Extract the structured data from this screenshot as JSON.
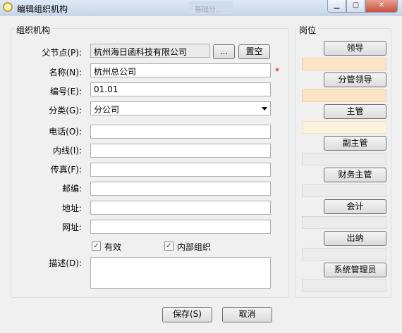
{
  "window": {
    "title": "编辑组织机构",
    "background_hint": "基础分..."
  },
  "org_group": {
    "title": "组织机构"
  },
  "fields": {
    "parent": {
      "label": "父节点(P):",
      "value": "杭州海日函科技有限公司",
      "browse_label": "...",
      "clear_label": "置空"
    },
    "name": {
      "label": "名称(N):",
      "value": "杭州总公司",
      "required_mark": "*"
    },
    "code": {
      "label": "编号(E):",
      "value": "01.01"
    },
    "category": {
      "label": "分类(G):",
      "value": "分公司"
    },
    "phone": {
      "label": "电话(O):",
      "value": ""
    },
    "extension": {
      "label": "内线(I):",
      "value": ""
    },
    "fax": {
      "label": "传真(F):",
      "value": ""
    },
    "postcode": {
      "label": "邮编:",
      "value": ""
    },
    "address": {
      "label": "地址:",
      "value": ""
    },
    "website": {
      "label": "网址:",
      "value": ""
    },
    "description": {
      "label": "描述(D):",
      "value": ""
    }
  },
  "checkboxes": {
    "valid": {
      "label": "有效",
      "checked": true
    },
    "internal": {
      "label": "内部组织",
      "checked": true
    }
  },
  "positions": {
    "title": "岗位",
    "items": [
      {
        "label": "领导",
        "value": ""
      },
      {
        "label": "分管领导",
        "value": ""
      },
      {
        "label": "主管",
        "value": ""
      },
      {
        "label": "副主管",
        "value": ""
      },
      {
        "label": "财务主管",
        "value": ""
      },
      {
        "label": "会计",
        "value": ""
      },
      {
        "label": "出纳",
        "value": ""
      },
      {
        "label": "系统管理员",
        "value": ""
      }
    ]
  },
  "footer": {
    "save_label": "保存(S)",
    "cancel_label": "取消"
  },
  "colors": {
    "title_bar": "#c6d7ec",
    "highlight_field": "#fde4c4",
    "required": "#d00000"
  }
}
